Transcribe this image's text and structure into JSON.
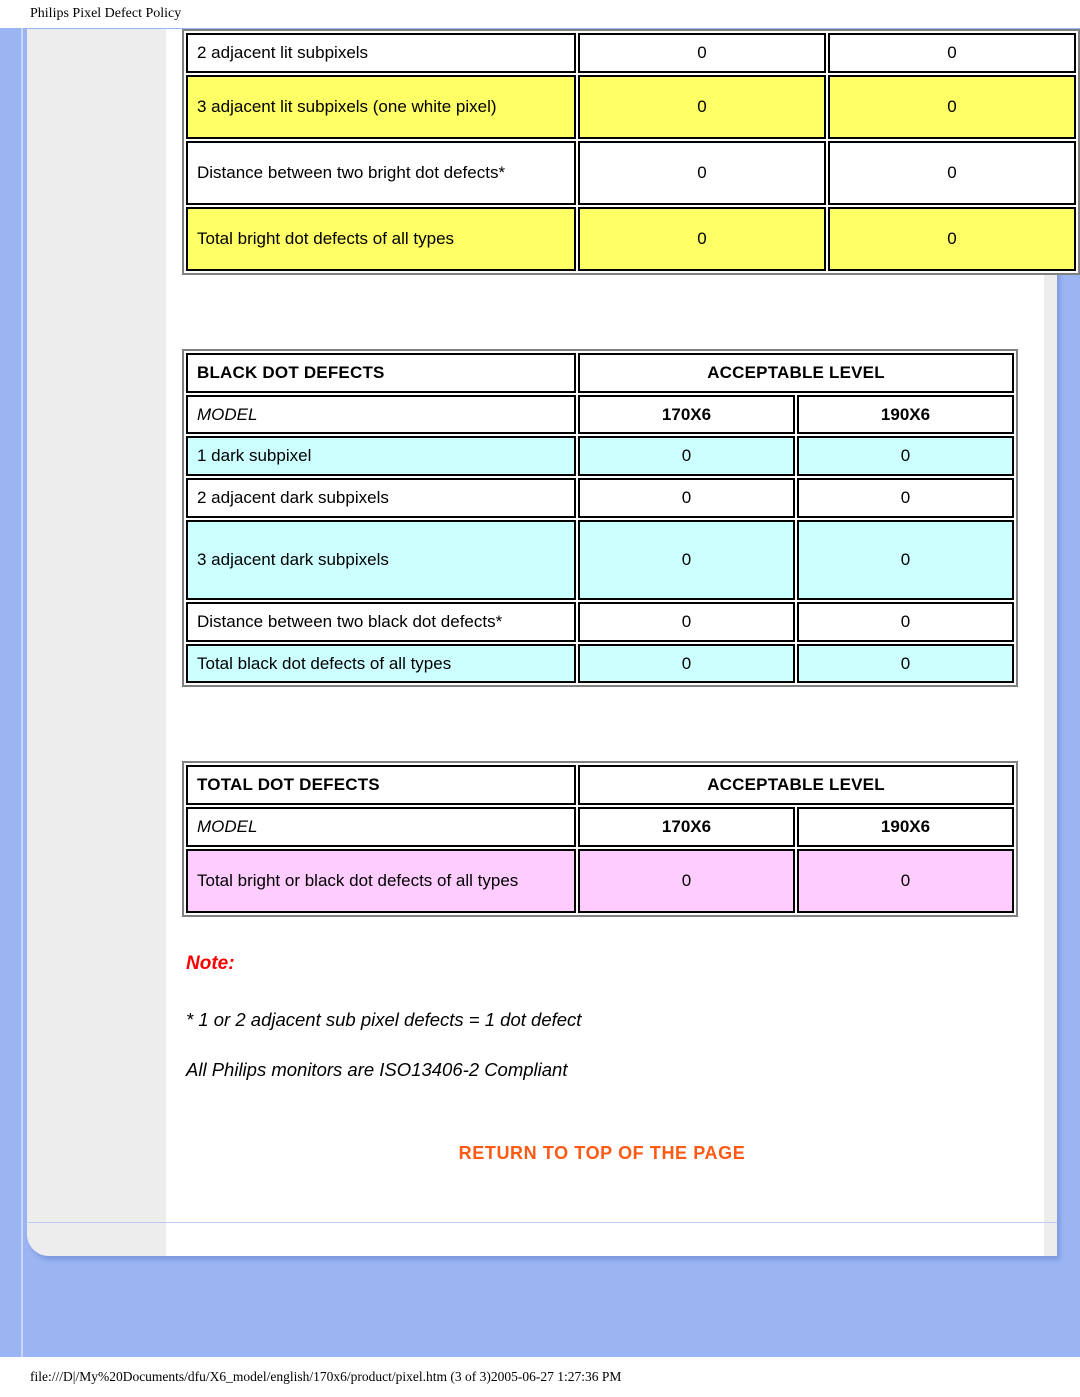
{
  "document_title": "Philips Pixel Defect Policy",
  "footer_path": "file:///D|/My%20Documents/dfu/X6_model/english/170x6/product/pixel.htm (3 of 3)2005-06-27 1:27:36 PM",
  "colors": {
    "page_background": "#9bb5f3",
    "panel": "#ffffff",
    "sidebar": "#ededed",
    "header_black": "#000000",
    "header_navy": "#000033",
    "row_yellow": "#ffff66",
    "row_cyan": "#ccffff",
    "row_pink": "#ffccff",
    "note_red": "#ff0000",
    "link_orange": "#ff5a14"
  },
  "bright_table": {
    "rows": [
      {
        "label": "2 adjacent lit subpixels",
        "v170": "0",
        "v190": "0",
        "fill": "white"
      },
      {
        "label": "3 adjacent lit subpixels (one white pixel)",
        "v170": "0",
        "v190": "0",
        "fill": "yellow"
      },
      {
        "label": "Distance between two bright dot defects*",
        "v170": "0",
        "v190": "0",
        "fill": "white"
      },
      {
        "label": "Total bright dot defects of all types",
        "v170": "0",
        "v190": "0",
        "fill": "yellow"
      }
    ]
  },
  "black_table": {
    "header_left": "BLACK DOT DEFECTS",
    "header_right": "ACCEPTABLE LEVEL",
    "model_label": "MODEL",
    "model_170": "170X6",
    "model_190": "190X6",
    "rows": [
      {
        "label": "1 dark subpixel",
        "v170": "0",
        "v190": "0",
        "fill": "cyan"
      },
      {
        "label": "2 adjacent dark subpixels",
        "v170": "0",
        "v190": "0",
        "fill": "white"
      },
      {
        "label": "3 adjacent dark subpixels",
        "v170": "0",
        "v190": "0",
        "fill": "cyan"
      },
      {
        "label": "Distance between two black dot defects*",
        "v170": "0",
        "v190": "0",
        "fill": "white"
      },
      {
        "label": "Total black dot defects of all types",
        "v170": "0",
        "v190": "0",
        "fill": "cyan"
      }
    ]
  },
  "total_table": {
    "header_left": "TOTAL DOT DEFECTS",
    "header_right": "ACCEPTABLE LEVEL",
    "model_label": "MODEL",
    "model_170": "170X6",
    "model_190": "190X6",
    "rows": [
      {
        "label": "Total bright or black dot defects of all types",
        "v170": "0",
        "v190": "0",
        "fill": "pink"
      }
    ]
  },
  "note": {
    "heading": "Note:",
    "line1": "* 1 or 2 adjacent sub pixel defects = 1 dot defect",
    "line2": "All Philips monitors are ISO13406-2 Compliant"
  },
  "return_link": "RETURN TO TOP OF THE PAGE"
}
